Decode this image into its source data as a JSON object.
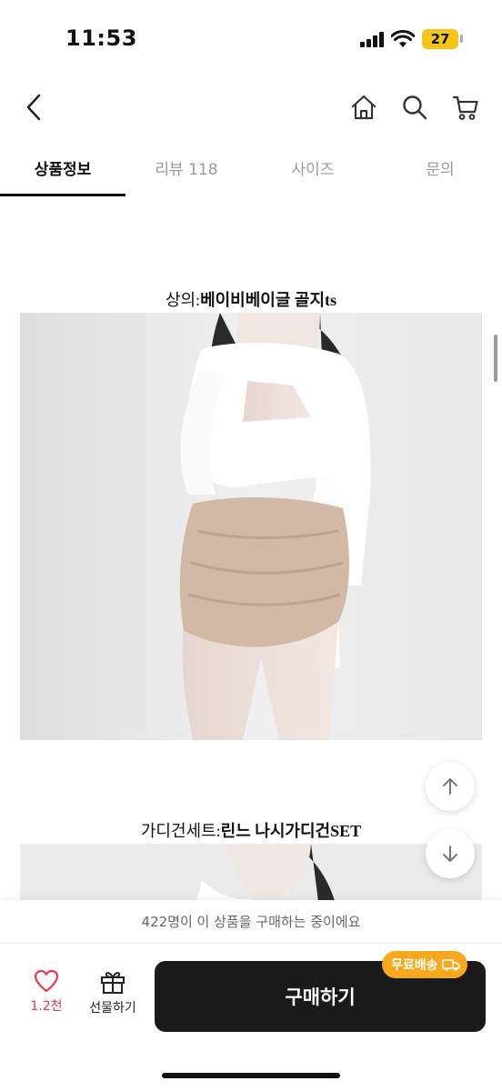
{
  "status_bar": {
    "time": "11:53",
    "battery_level": "27",
    "battery_color": "#f5c518"
  },
  "nav": {
    "back_icon": "chevron-left-icon",
    "home_icon": "home-icon",
    "search_icon": "search-icon",
    "cart_icon": "cart-icon"
  },
  "tabs": [
    {
      "label": "상품정보",
      "active": true
    },
    {
      "label": "리뷰 118",
      "active": false
    },
    {
      "label": "사이즈",
      "active": false
    },
    {
      "label": "문의",
      "active": false
    }
  ],
  "content": {
    "section1": {
      "prefix": "상의:",
      "name": "베이비베이글 골지ts"
    },
    "section2": {
      "prefix": "가디건세트:",
      "name": "린느 나시가디건SET"
    }
  },
  "floating": {
    "scroll_up_icon": "arrow-up-icon",
    "scroll_down_icon": "arrow-down-icon"
  },
  "bottom": {
    "purchase_notice": "422명이 이 상품을 구매하는 중이에요",
    "like_count": "1.2천",
    "gift_label": "선물하기",
    "buy_label": "구매하기",
    "free_shipping_badge": "무료배송",
    "accent_color": "#e53950",
    "badge_color": "#f7a81b"
  }
}
